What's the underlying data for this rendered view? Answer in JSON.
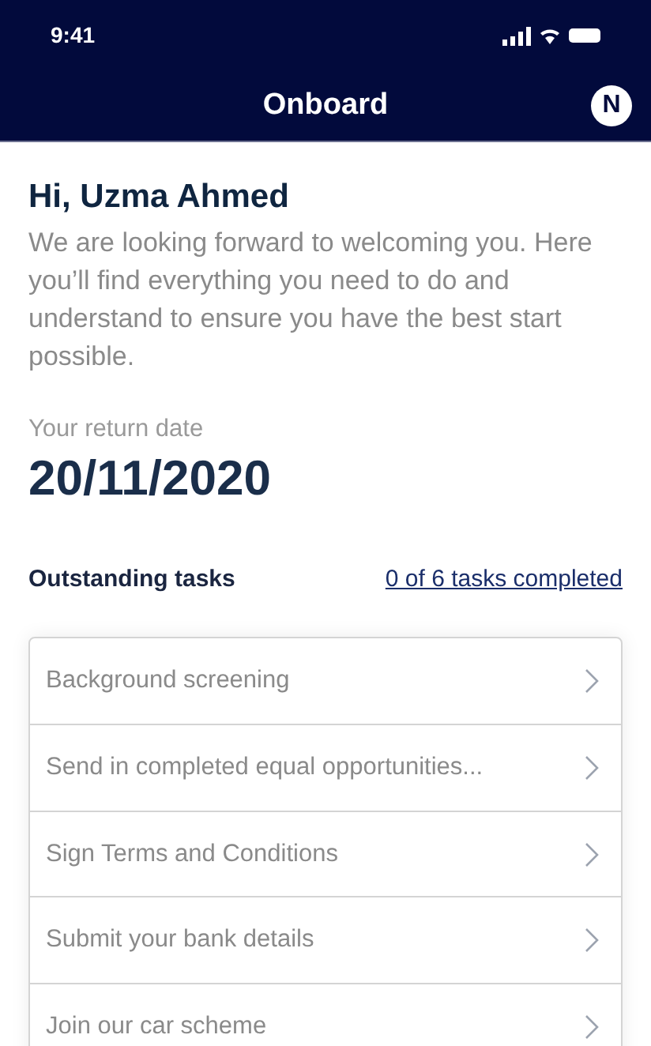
{
  "status_bar": {
    "time": "9:41"
  },
  "header": {
    "title": "Onboard",
    "avatar": "N"
  },
  "greeting": "Hi, Uzma Ahmed",
  "intro": "We are looking forward to welcoming you. Here you’ll find everything you need to do and understand to ensure you have the best start possible.",
  "return_date": {
    "label": "Your return date",
    "value": "20/11/2020"
  },
  "tasks": {
    "heading": "Outstanding tasks",
    "progress_link": "0 of 6 tasks completed",
    "items": [
      {
        "label": "Background screening"
      },
      {
        "label": "Send in completed equal opportunities..."
      },
      {
        "label": "Sign Terms and Conditions"
      },
      {
        "label": "Submit your bank details"
      },
      {
        "label": "Join our car scheme"
      }
    ]
  }
}
